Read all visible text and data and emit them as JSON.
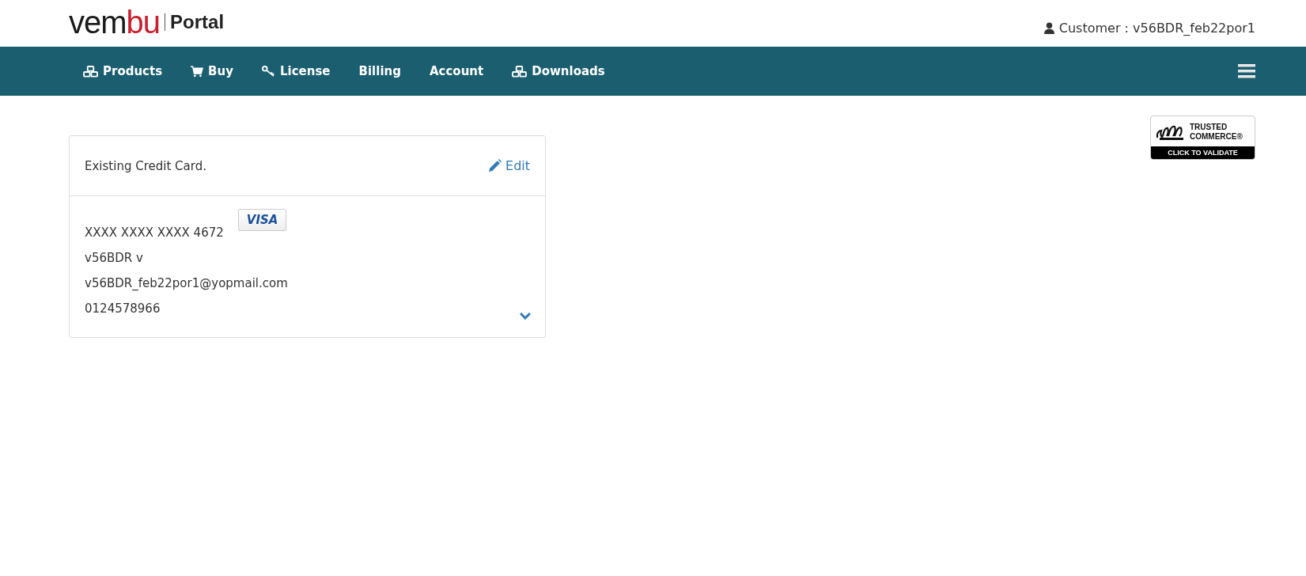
{
  "header": {
    "logo": {
      "text_dark": "vem",
      "text_accent": "bu",
      "product": "Portal"
    },
    "customer": "Customer : v56BDR_feb22por1"
  },
  "nav": {
    "items": [
      {
        "label": "Products",
        "kind": "boxes"
      },
      {
        "label": "Buy",
        "kind": "cart"
      },
      {
        "label": "License",
        "kind": "key"
      },
      {
        "label": "Billing",
        "kind": "plain"
      },
      {
        "label": "Account",
        "kind": "plain"
      },
      {
        "label": "Downloads",
        "kind": "boxes"
      }
    ]
  },
  "trust_badge": {
    "line_1": "TRUSTED",
    "line_2": "COMMERCE®",
    "footer": "CLICK TO VALIDATE"
  },
  "card": {
    "title": "Existing Credit Card.",
    "edit": "Edit",
    "card_brand": "VISA",
    "number": "XXXX XXXX XXXX 4672",
    "name": "v56BDR v",
    "email": "v56BDR_feb22por1@yopmail.com",
    "phone": "0124578966",
    "expanded": false
  }
}
